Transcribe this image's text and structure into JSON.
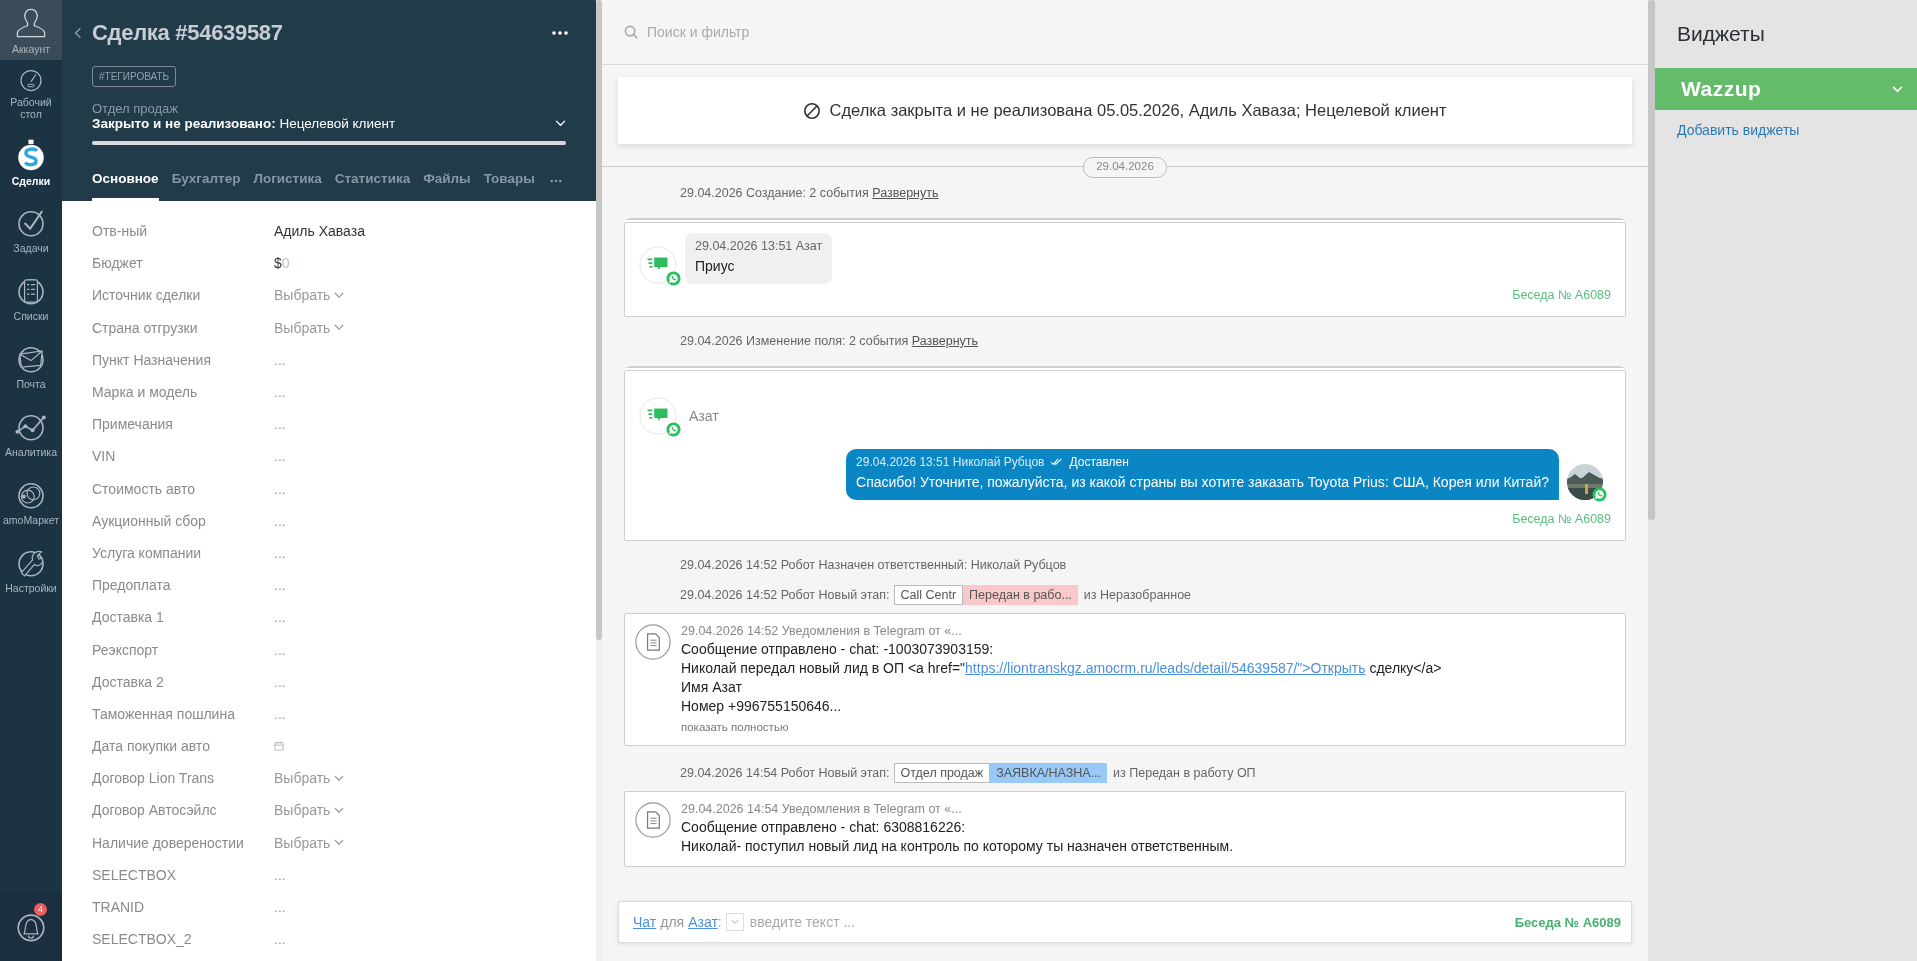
{
  "nav": {
    "items": [
      {
        "label": "Аккаунт",
        "selected": false
      },
      {
        "label": "Рабочий стол",
        "selected": false
      },
      {
        "label": "Сделки",
        "selected": true
      },
      {
        "label": "Задачи",
        "selected": false
      },
      {
        "label": "Списки",
        "selected": false
      },
      {
        "label": "Почта",
        "selected": false
      },
      {
        "label": "Аналитика",
        "selected": false
      },
      {
        "label": "amoМаркет",
        "selected": false
      },
      {
        "label": "Настройки",
        "selected": false
      }
    ],
    "notifications": {
      "count": "4"
    }
  },
  "lead": {
    "title": "Сделка #54639587",
    "tag_button": "#ТЕГИРОВАТЬ",
    "pipeline": "Отдел продаж",
    "progress": {
      "level": 1
    },
    "status": "**Закрыто и не реализовано:** Нецелевой клиент",
    "tabs": [
      {
        "label": "Основное",
        "selected": true
      },
      {
        "label": "Бухгалтер",
        "selected": false
      },
      {
        "label": "Логистика",
        "selected": false
      },
      {
        "label": "Статистика",
        "selected": false
      },
      {
        "label": "Файлы",
        "selected": false
      },
      {
        "label": "Товары",
        "selected": false
      }
    ],
    "fields": [
      {
        "label": "Отв-ный",
        "kind": "text",
        "value": "Адиль Хаваза"
      },
      {
        "label": "Бюджет",
        "kind": "money",
        "currency": "$",
        "value": "0"
      },
      {
        "label": "Источник сделки",
        "kind": "select",
        "value": "Выбрать"
      },
      {
        "label": "Страна отгрузки",
        "kind": "select",
        "value": "Выбрать"
      },
      {
        "label": "Пункт Назначения",
        "kind": "empty",
        "value": "..."
      },
      {
        "label": "Марка и модель",
        "kind": "empty",
        "value": "..."
      },
      {
        "label": "Примечания",
        "kind": "empty",
        "value": "..."
      },
      {
        "label": "VIN",
        "kind": "empty",
        "value": "..."
      },
      {
        "label": "Стоимость авто",
        "kind": "empty",
        "value": "..."
      },
      {
        "label": "Аукционный сбор",
        "kind": "empty",
        "value": "..."
      },
      {
        "label": "Услуга компании",
        "kind": "empty",
        "value": "..."
      },
      {
        "label": "Предоплата",
        "kind": "empty",
        "value": "..."
      },
      {
        "label": "Доставка 1",
        "kind": "empty",
        "value": "..."
      },
      {
        "label": "Реэкспорт",
        "kind": "empty",
        "value": "..."
      },
      {
        "label": "Доставка 2",
        "kind": "empty",
        "value": "..."
      },
      {
        "label": "Таможенная пошлина",
        "kind": "empty",
        "value": "..."
      },
      {
        "label": "Дата покупки авто",
        "kind": "date"
      },
      {
        "label": "Договор Lion Trans",
        "kind": "select",
        "value": "Выбрать"
      },
      {
        "label": "Договор Автосэйлс",
        "kind": "select",
        "value": "Выбрать"
      },
      {
        "label": "Наличие довереностии",
        "kind": "select",
        "value": "Выбрать"
      },
      {
        "label": "SELECTBOX",
        "kind": "empty",
        "value": "..."
      },
      {
        "label": "TRANID",
        "kind": "empty",
        "value": "..."
      },
      {
        "label": "SELECTBOX_2",
        "kind": "empty",
        "value": "..."
      }
    ]
  },
  "feed": {
    "search": {
      "placeholder": "Поиск и фильтр"
    },
    "banner": "Сделка закрыта и не реализована 05.05.2026, Адиль Хаваза; Нецелевой клиент",
    "date": "29.04.2026",
    "items": [
      {
        "kind": "note",
        "text": "29.04.2026 Создание: 2 события",
        "link": "Развернуть"
      },
      {
        "kind": "chat",
        "message": {
          "kind": "incoming",
          "meta": "29.04.2026 13:51 Азат",
          "text": "Приус"
        },
        "conversation": "Беседа № A6089"
      },
      {
        "kind": "note",
        "text": "29.04.2026 Изменение поля: 2 события",
        "link": "Развернуть"
      },
      {
        "kind": "chat",
        "sender": "Азат",
        "message": {
          "kind": "outgoing",
          "meta": "29.04.2026 13:51 Николай Рубцов",
          "status": "Доставлен",
          "text": "Спасибо! Уточните, пожалуйста, из какой страны вы хотите заказать Toyota Prius: США, Корея или Китай?"
        },
        "conversation": "Беседа № A6089"
      },
      {
        "kind": "event",
        "text": "29.04.2026 14:52 Робот Назначен ответственный: Николай Рубцов"
      },
      {
        "kind": "stage",
        "text": "29.04.2026 14:52 Робот Новый этап:",
        "from": "Call Centr",
        "to": "Передан в рабо...",
        "color": "#f9c8c8",
        "suffix": "из Неразобранное"
      },
      {
        "kind": "notification",
        "meta": "29.04.2026 14:52 Уведомления в Telegram от «...",
        "lines": [
          {
            "text": "Сообщение отправлено - chat: -1003073903159:"
          },
          {
            "text": "Николай передал новый лид в ОП <a href=\"",
            "link": "https://liontranskgz.amocrm.ru/leads/detail/54639587/\">Открыть",
            "after": " сделку</a>"
          },
          {
            "text": "Имя Азат"
          },
          {
            "text": "Номер +996755150646..."
          }
        ],
        "more": "показать полностью"
      },
      {
        "kind": "stage",
        "text": "29.04.2026 14:54 Робот Новый этап:",
        "from": "Отдел продаж",
        "to": "ЗАЯВКА/НАЗНА...",
        "color": "#99c9f7",
        "suffix": "из Передан в работу ОП"
      },
      {
        "kind": "notification",
        "meta": "29.04.2026 14:54 Уведомления в Telegram от «...",
        "lines": [
          {
            "text": "Сообщение отправлено - chat: 6308816226:"
          },
          {
            "text": "Николай- поступил новый лид на контроль по которому ты назначен ответственным."
          }
        ]
      }
    ],
    "composer": {
      "chat_link": "Чат",
      "for": "для",
      "contact_link": "Азат",
      "colon": ":",
      "placeholder": "введите текст ...",
      "conversation": "Беседа № A6089"
    }
  },
  "widgets": {
    "title": "Виджеты",
    "items": [
      {
        "name": "Wazzup",
        "expanded": false
      }
    ],
    "add_link": "Добавить виджеты"
  }
}
